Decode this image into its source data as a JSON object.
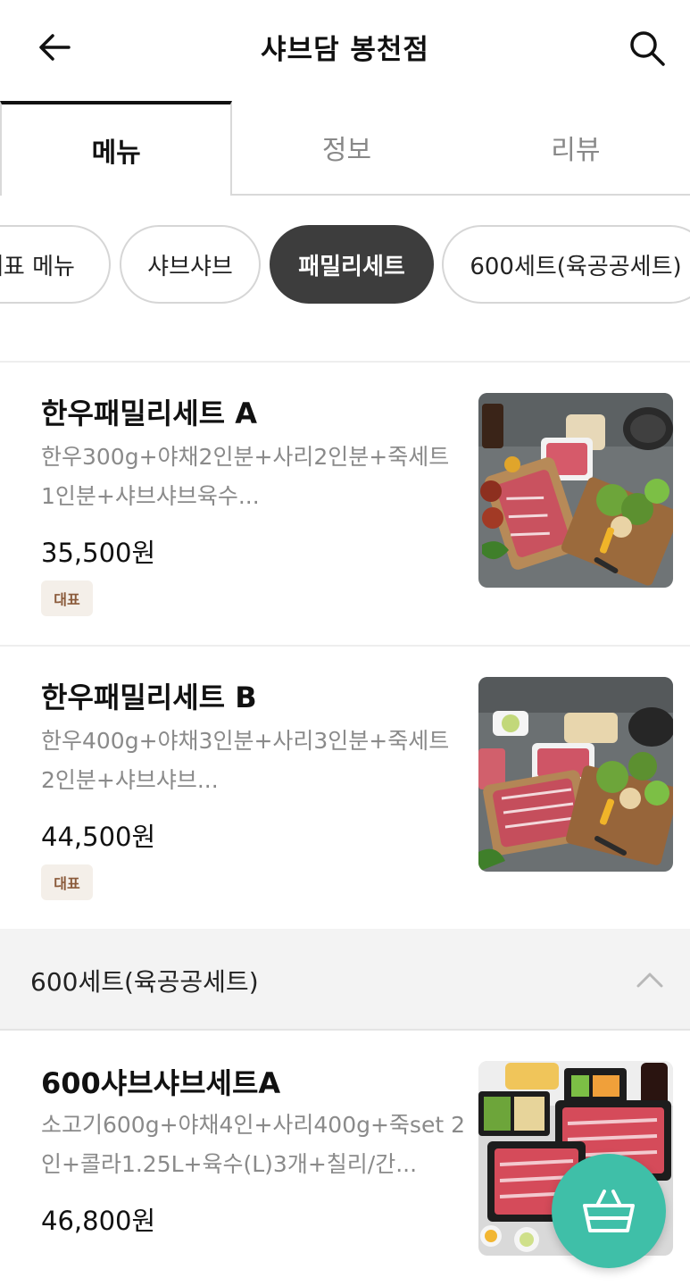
{
  "header": {
    "title": "샤브담 봉천점",
    "back_icon": "arrow-left-icon",
    "search_icon": "search-icon"
  },
  "tabs": [
    {
      "label": "메뉴",
      "active": true
    },
    {
      "label": "정보",
      "active": false
    },
    {
      "label": "리뷰",
      "active": false
    }
  ],
  "categories": [
    {
      "label": "대표 메뉴",
      "active": false
    },
    {
      "label": "샤브샤브",
      "active": false
    },
    {
      "label": "패밀리세트",
      "active": true
    },
    {
      "label": "600세트(육공공세트)",
      "active": false
    }
  ],
  "menu_items": [
    {
      "name": "한우패밀리세트 A",
      "description": "한우300g+야채2인분+사리2인분+죽세트 1인분+샤브샤브육수...",
      "price": "35,500원",
      "badge": "대표"
    },
    {
      "name": "한우패밀리세트 B",
      "description": "한우400g+야채3인분+사리3인분+죽세트 2인분+샤브샤브...",
      "price": "44,500원",
      "badge": "대표"
    }
  ],
  "section": {
    "title": "600세트(육공공세트)",
    "chevron_icon": "chevron-up-icon"
  },
  "section_items": [
    {
      "name": "600샤브샤브세트A",
      "description": "소고기600g+야채4인+사리400g+죽set 2인+콜라1.25L+육수(L)3개+칠리/간...",
      "price": "46,800원"
    }
  ],
  "cart": {
    "icon": "shopping-basket-icon",
    "color": "#3fbfa8"
  }
}
